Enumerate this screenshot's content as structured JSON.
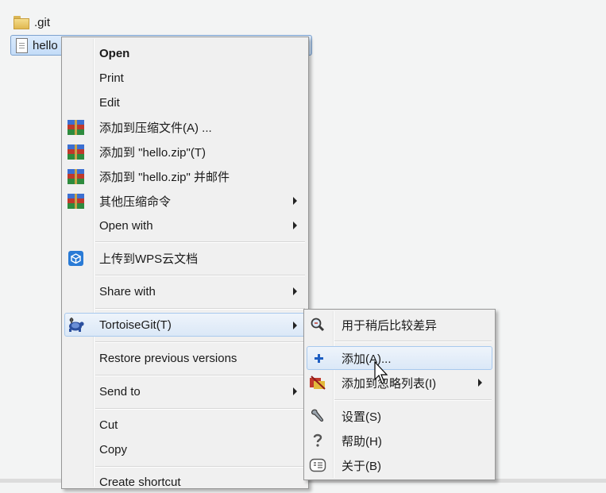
{
  "files": [
    {
      "name": ".git",
      "icon": "folder-icon"
    },
    {
      "name": "hello",
      "icon": "file-icon"
    }
  ],
  "context_menu": {
    "items": [
      {
        "label": "Open",
        "bold": true
      },
      {
        "label": "Print"
      },
      {
        "label": "Edit"
      },
      {
        "label": "添加到压缩文件(A) ...",
        "icon": "winrar-icon"
      },
      {
        "label": "添加到 \"hello.zip\"(T)",
        "icon": "winrar-icon"
      },
      {
        "label": "添加到 \"hello.zip\" 并邮件",
        "icon": "winrar-icon"
      },
      {
        "label": "其他压缩命令",
        "icon": "winrar-icon",
        "submenu": true
      },
      {
        "label": "Open with",
        "submenu": true
      },
      {
        "label": "上传到WPS云文档",
        "icon": "wps-cloud-icon"
      },
      {
        "label": "Share with",
        "submenu": true
      },
      {
        "label": "TortoiseGit(T)",
        "icon": "tortoisegit-icon",
        "submenu": true,
        "active": true
      },
      {
        "label": "Restore previous versions"
      },
      {
        "label": "Send to",
        "submenu": true
      },
      {
        "label": "Cut"
      },
      {
        "label": "Copy"
      },
      {
        "label": "Create shortcut"
      }
    ]
  },
  "submenu": {
    "items": [
      {
        "label": "用于稍后比较差异",
        "icon": "diff-magnifier-icon"
      },
      {
        "label": "添加(A)...",
        "icon": "add-plus-icon",
        "hover": true
      },
      {
        "label": "添加到忽略列表(I)",
        "icon": "ignore-icon",
        "submenu": true
      },
      {
        "label": "设置(S)",
        "icon": "settings-wrench-icon"
      },
      {
        "label": "帮助(H)",
        "icon": "help-icon"
      },
      {
        "label": "关于(B)",
        "icon": "about-icon"
      }
    ]
  },
  "colors": {
    "menu_bg": "#f0f0f0",
    "hover_border": "#a8c9ee",
    "selection": "#c3dcf8"
  }
}
